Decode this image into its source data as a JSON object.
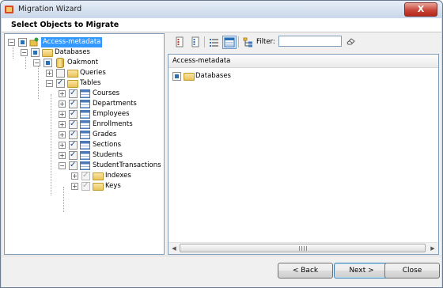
{
  "window": {
    "title": "Migration Wizard",
    "close_label": "X"
  },
  "header": {
    "title": "Select Objects to Migrate"
  },
  "tree": {
    "root": "Access-metadata",
    "databases": "Databases",
    "db_name": "Oakmont",
    "queries": "Queries",
    "tables": "Tables",
    "table_items": [
      "Courses",
      "Departments",
      "Employees",
      "Enrollments",
      "Grades",
      "Sections",
      "Students",
      "StudentTransactions"
    ],
    "indexes": "Indexes",
    "keys": "Keys"
  },
  "toolbar": {
    "filter_label": "Filter:",
    "filter_value": ""
  },
  "details": {
    "column_header": "Access-metadata",
    "item": "Databases"
  },
  "buttons": {
    "back": "< Back",
    "next": "Next >",
    "close": "Close"
  }
}
